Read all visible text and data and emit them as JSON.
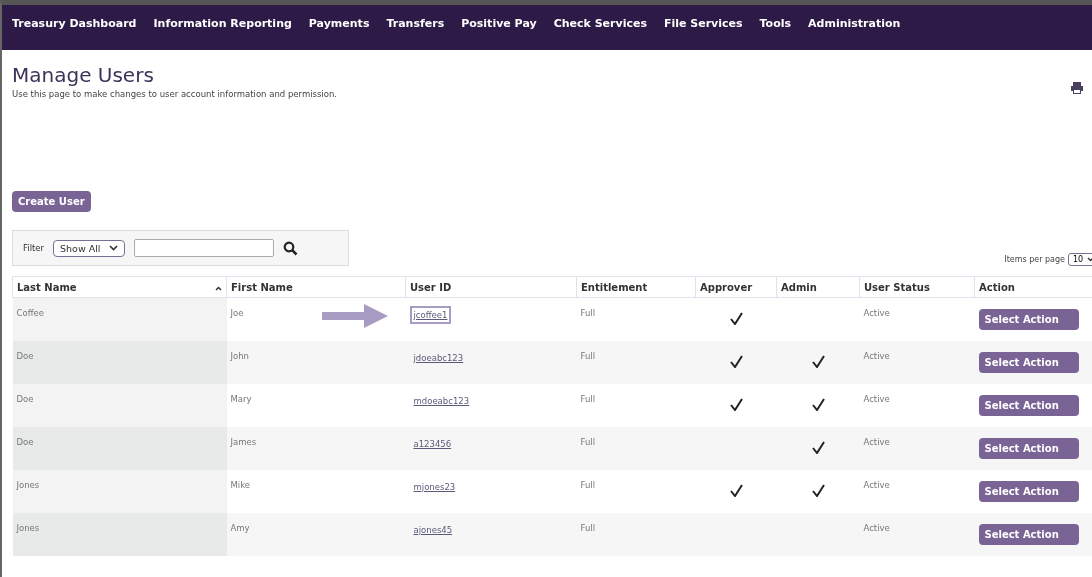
{
  "nav": [
    "Treasury Dashboard",
    "Information Reporting",
    "Payments",
    "Transfers",
    "Positive Pay",
    "Check Services",
    "File Services",
    "Tools",
    "Administration"
  ],
  "page": {
    "title": "Manage Users",
    "description": "Use this page to make changes to user account information and permission."
  },
  "create_button": "Create User",
  "filter": {
    "label": "Filter",
    "select_value": "Show All"
  },
  "items_per_page": {
    "label": "Items per page",
    "value": "10"
  },
  "table": {
    "columns": [
      {
        "label": "Last Name",
        "sorted": true
      },
      {
        "label": "First Name",
        "sorted": false
      },
      {
        "label": "User ID",
        "sorted": false
      },
      {
        "label": "Entitlement",
        "sorted": false
      },
      {
        "label": "Approver",
        "sorted": false
      },
      {
        "label": "Admin",
        "sorted": false
      },
      {
        "label": "User Status",
        "sorted": false
      },
      {
        "label": "Action",
        "sorted": false
      }
    ],
    "rows": [
      {
        "last": "Coffee",
        "first": "Joe",
        "user_id": "jcoffee1",
        "entitlement": "Full",
        "approver": true,
        "admin": false,
        "status": "Active",
        "action": "Select Action",
        "highlighted": true
      },
      {
        "last": "Doe",
        "first": "John",
        "user_id": "jdoeabc123",
        "entitlement": "Full",
        "approver": true,
        "admin": true,
        "status": "Active",
        "action": "Select Action",
        "highlighted": false
      },
      {
        "last": "Doe",
        "first": "Mary",
        "user_id": "mdoeabc123",
        "entitlement": "Full",
        "approver": true,
        "admin": true,
        "status": "Active",
        "action": "Select Action",
        "highlighted": false
      },
      {
        "last": "Doe",
        "first": "James",
        "user_id": "a123456",
        "entitlement": "Full",
        "approver": false,
        "admin": true,
        "status": "Active",
        "action": "Select Action",
        "highlighted": false
      },
      {
        "last": "Jones",
        "first": "Mike",
        "user_id": "mjones23",
        "entitlement": "Full",
        "approver": true,
        "admin": true,
        "status": "Active",
        "action": "Select Action",
        "highlighted": false
      },
      {
        "last": "Jones",
        "first": "Amy",
        "user_id": "ajones45",
        "entitlement": "Full",
        "approver": false,
        "admin": false,
        "status": "Active",
        "action": "Select Action",
        "highlighted": false
      }
    ]
  }
}
